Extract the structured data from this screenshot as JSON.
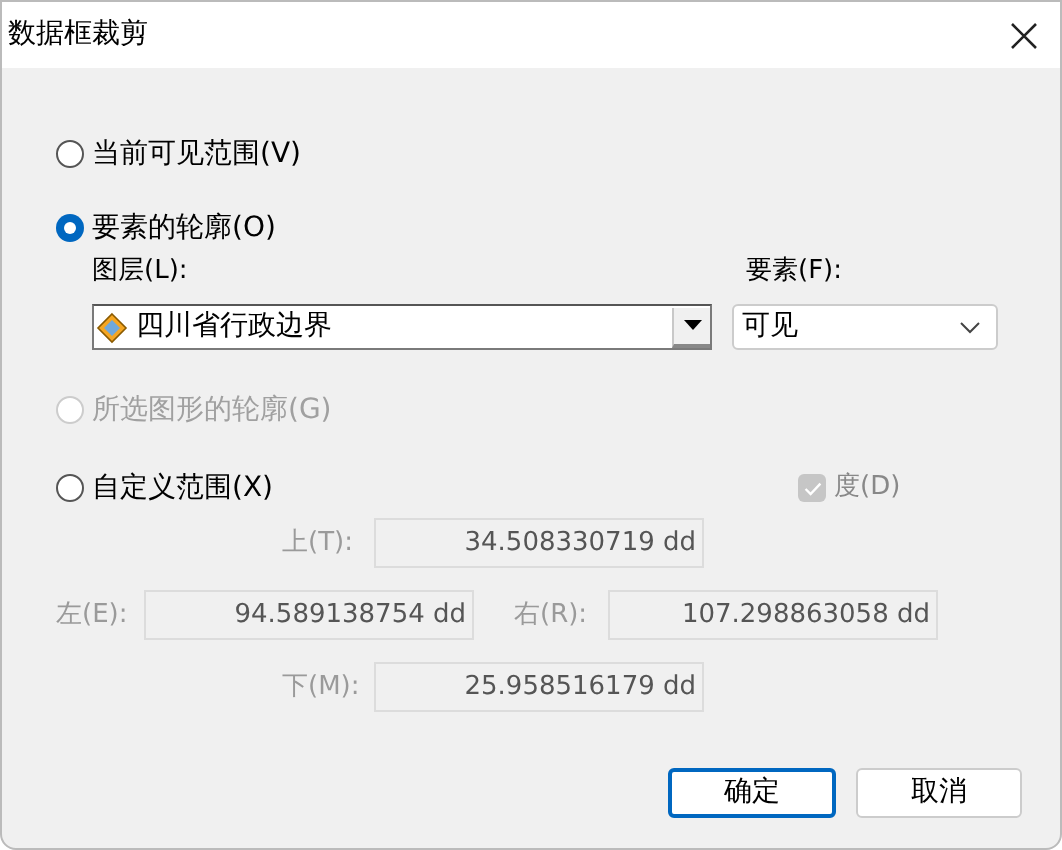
{
  "window": {
    "title": "数据框裁剪"
  },
  "options": [
    {
      "label": "当前可见范围(V)",
      "selected": false,
      "disabled": false
    },
    {
      "label": "要素的轮廓(O)",
      "selected": true,
      "disabled": false
    },
    {
      "label": "所选图形的轮廓(G)",
      "selected": false,
      "disabled": true
    },
    {
      "label": "自定义范围(X)",
      "selected": false,
      "disabled": false
    }
  ],
  "layer_select": {
    "label": "图层(L):",
    "value": "四川省行政边界"
  },
  "feature_select": {
    "label": "要素(F):",
    "value": "可见"
  },
  "degrees_checkbox": {
    "label": "度(D)",
    "checked": true,
    "disabled": true
  },
  "extent_fields": [
    {
      "label": "上(T):",
      "value": "34.508330719 dd",
      "disabled": true
    },
    {
      "label": "左(E):",
      "value": "94.589138754 dd",
      "disabled": true
    },
    {
      "label": "右(R):",
      "value": "107.298863058 dd",
      "disabled": true
    },
    {
      "label": "下(M):",
      "value": "25.958516179 dd",
      "disabled": true
    }
  ],
  "buttons": [
    {
      "label": "确定",
      "default": true
    },
    {
      "label": "取消",
      "default": false
    }
  ]
}
